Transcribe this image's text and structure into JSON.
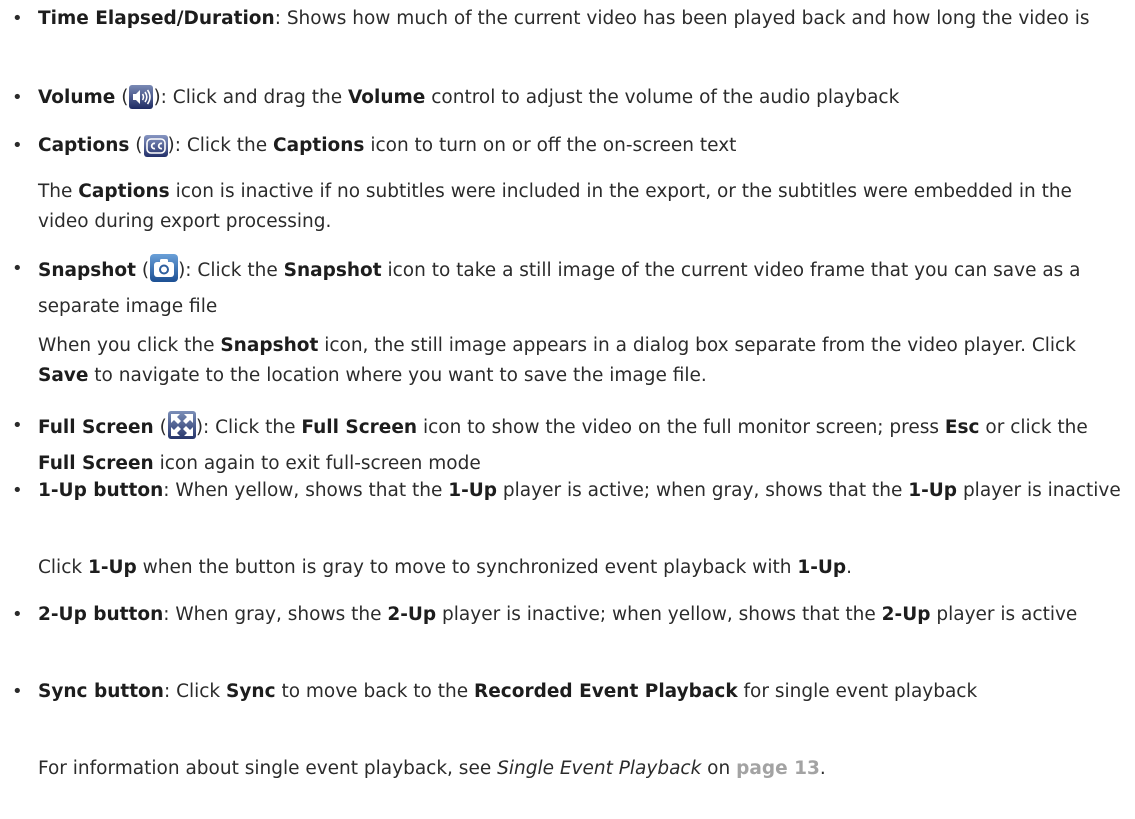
{
  "bullet": "•",
  "items": {
    "time": {
      "term": "Time Elapsed/Duration",
      "rest": ": Shows how much of the current video has been played back and how long the video is"
    },
    "volume": {
      "term": "Volume",
      "open": " (",
      "close": "): Click and drag the ",
      "term2": "Volume",
      "rest": " control to adjust the volume of the audio playback"
    },
    "captions": {
      "term": "Captions",
      "open": " (",
      "close": "): Click the ",
      "term2": "Captions",
      "rest": " icon to turn on or off the on-screen text",
      "note_pre": "The ",
      "note_term": "Captions",
      "note_rest": " icon is inactive if no subtitles were included in the export, or the subtitles were embedded in the video during export processing."
    },
    "snapshot": {
      "term": "Snapshot",
      "open": " (",
      "close": "): Click the ",
      "term2": "Snapshot",
      "rest": " icon to take a still image of the current video frame that you can save as a separate image file",
      "note_pre": "When you click the ",
      "note_term": "Snapshot",
      "note_mid": " icon, the still image appears in a dialog box separate from the video player. Click ",
      "note_term2": "Save",
      "note_rest": " to navigate to the location where you want to save the image file."
    },
    "fullscreen": {
      "term": "Full Screen",
      "open": " (",
      "close": "): Click the ",
      "term2": "Full Screen",
      "mid": " icon to show the video on the full monitor screen; press ",
      "term3": "Esc",
      "mid2": " or click the ",
      "term4": "Full Screen",
      "rest": " icon again to exit full-screen mode"
    },
    "oneup": {
      "term": "1-Up button",
      "mid": ": When yellow, shows that the ",
      "term2": "1-Up",
      "mid2": " player is active; when gray, shows that the ",
      "term3": "1-Up",
      "rest": " player is inactive",
      "note_pre": "Click ",
      "note_term": "1-Up",
      "note_mid": " when the button is gray to move to synchronized event playback with ",
      "note_term2": "1-Up",
      "note_rest": "."
    },
    "twoup": {
      "term": "2-Up button",
      "mid": ": When gray, shows the ",
      "term2": "2-Up",
      "mid2": " player is inactive; when yellow, shows that the ",
      "term3": "2-Up",
      "rest": " player is active"
    },
    "sync": {
      "term": "Sync button",
      "mid": ": Click ",
      "term2": "Sync",
      "mid2": " to move back to the ",
      "term3": "Recorded Event Playback",
      "rest": " for single event playback",
      "note_pre": "For information about single event playback, see ",
      "note_italic": "Single Event Playback",
      "note_mid": " on ",
      "note_link": "page 13",
      "note_rest": "."
    }
  },
  "icons": {
    "volume": "speaker-icon",
    "captions": "closed-captions-icon",
    "snapshot": "camera-icon",
    "fullscreen": "fullscreen-arrows-icon"
  },
  "colors": {
    "text": "#2b2b2b",
    "page_link": "#a3a3a3"
  }
}
